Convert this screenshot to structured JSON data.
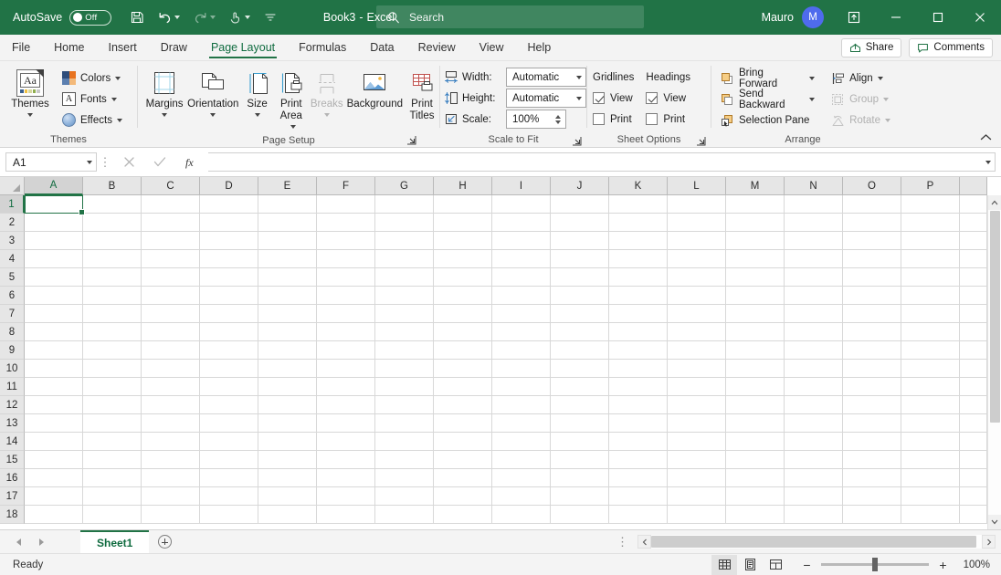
{
  "titlebar": {
    "autosave_label": "AutoSave",
    "autosave_state": "Off",
    "save_icon": "save-icon",
    "undo_icon": "undo-icon",
    "redo_icon": "redo-icon",
    "touch_icon": "touch-mode-icon",
    "customize_icon": "customize-quick-access-icon",
    "doc_title": "Book3",
    "doc_separator": "-",
    "app_name": "Excel",
    "search_placeholder": "Search",
    "search_icon": "search-icon",
    "user_name": "Mauro",
    "user_initial": "M",
    "ribbon_display_icon": "ribbon-display-options-icon",
    "minimize_icon": "minimize-icon",
    "maximize_icon": "maximize-icon",
    "close_icon": "close-icon",
    "accent_color": "#217346",
    "avatar_color": "#4f6bed"
  },
  "tabs": {
    "items": [
      {
        "label": "File",
        "active": false
      },
      {
        "label": "Home",
        "active": false
      },
      {
        "label": "Insert",
        "active": false
      },
      {
        "label": "Draw",
        "active": false
      },
      {
        "label": "Page Layout",
        "active": true
      },
      {
        "label": "Formulas",
        "active": false
      },
      {
        "label": "Data",
        "active": false
      },
      {
        "label": "Review",
        "active": false
      },
      {
        "label": "View",
        "active": false
      },
      {
        "label": "Help",
        "active": false
      }
    ],
    "share_label": "Share",
    "share_icon": "share-icon",
    "comments_label": "Comments",
    "comments_icon": "comments-icon",
    "collapse_icon": "collapse-ribbon-icon"
  },
  "ribbon": {
    "themes": {
      "group_label": "Themes",
      "themes_button": "Themes",
      "colors_label": "Colors",
      "fonts_label": "Fonts",
      "fonts_glyph": "A",
      "effects_label": "Effects",
      "themes_glyph": "Aa"
    },
    "page_setup": {
      "group_label": "Page Setup",
      "buttons": [
        {
          "label": "Margins",
          "icon": "margins-icon",
          "caret": true,
          "disabled": false
        },
        {
          "label": "Orientation",
          "icon": "orientation-icon",
          "caret": true,
          "disabled": false
        },
        {
          "label": "Size",
          "icon": "size-icon",
          "caret": true,
          "disabled": false
        },
        {
          "label": "Print",
          "label2": "Area",
          "icon": "print-area-icon",
          "caret": true,
          "inline_caret": true,
          "disabled": false
        },
        {
          "label": "Breaks",
          "icon": "breaks-icon",
          "caret": true,
          "disabled": true
        },
        {
          "label": "Background",
          "icon": "background-icon",
          "caret": false,
          "disabled": false
        },
        {
          "label": "Print",
          "label2": "Titles",
          "icon": "print-titles-icon",
          "caret": false,
          "disabled": false
        }
      ],
      "dialog_launcher_icon": "dialog-launcher-icon",
      "highlight_color": "#e81123"
    },
    "scale_to_fit": {
      "group_label": "Scale to Fit",
      "width_label": "Width:",
      "width_value": "Automatic",
      "width_icon": "fit-width-icon",
      "height_label": "Height:",
      "height_value": "Automatic",
      "height_icon": "fit-height-icon",
      "scale_label": "Scale:",
      "scale_value": "100%",
      "scale_icon": "scale-icon",
      "dialog_launcher_icon": "dialog-launcher-icon"
    },
    "sheet_options": {
      "group_label": "Sheet Options",
      "gridlines_header": "Gridlines",
      "headings_header": "Headings",
      "gridlines_view": {
        "label": "View",
        "checked": true
      },
      "gridlines_print": {
        "label": "Print",
        "checked": false
      },
      "headings_view": {
        "label": "View",
        "checked": true
      },
      "headings_print": {
        "label": "Print",
        "checked": false
      },
      "dialog_launcher_icon": "dialog-launcher-icon"
    },
    "arrange": {
      "group_label": "Arrange",
      "items": [
        {
          "label": "Bring Forward",
          "icon": "bring-forward-icon",
          "caret": true,
          "disabled": false
        },
        {
          "label": "Send Backward",
          "icon": "send-backward-icon",
          "caret": true,
          "disabled": false
        },
        {
          "label": "Selection Pane",
          "icon": "selection-pane-icon",
          "caret": false,
          "disabled": false
        },
        {
          "label": "Align",
          "icon": "align-icon",
          "caret": true,
          "disabled": false
        },
        {
          "label": "Group",
          "icon": "group-icon",
          "caret": true,
          "disabled": true
        },
        {
          "label": "Rotate",
          "icon": "rotate-icon",
          "caret": true,
          "disabled": true
        }
      ]
    }
  },
  "formula_bar": {
    "name_box_value": "A1",
    "name_box_caret_icon": "chevron-down-icon",
    "cancel_icon": "cancel-icon",
    "enter_icon": "enter-icon",
    "function_icon": "insert-function-icon",
    "formula_value": "",
    "expand_icon": "expand-formula-bar-icon"
  },
  "grid": {
    "columns": [
      "A",
      "B",
      "C",
      "D",
      "E",
      "F",
      "G",
      "H",
      "I",
      "J",
      "K",
      "L",
      "M",
      "N",
      "O",
      "P"
    ],
    "rows": [
      1,
      2,
      3,
      4,
      5,
      6,
      7,
      8,
      9,
      10,
      11,
      12,
      13,
      14,
      15,
      16,
      17,
      18
    ],
    "selected_cell": "A1",
    "selected_column": "A",
    "selected_row": 1,
    "selection_color": "#217346",
    "scroll_up_icon": "scroll-up-icon",
    "scroll_down_icon": "scroll-down-icon"
  },
  "sheet_bar": {
    "prev_icon": "previous-sheet-icon",
    "next_icon": "next-sheet-icon",
    "sheets": [
      {
        "name": "Sheet1",
        "active": true
      }
    ],
    "add_sheet_icon": "add-sheet-icon",
    "overflow_icon": "sheet-tab-overflow-icon",
    "scroll_left_icon": "scroll-left-icon",
    "scroll_right_icon": "scroll-right-icon"
  },
  "status_bar": {
    "status_text": "Ready",
    "views": [
      {
        "name": "normal-view",
        "icon": "normal-view-icon",
        "active": true
      },
      {
        "name": "page-layout-view",
        "icon": "page-layout-view-icon",
        "active": false
      },
      {
        "name": "page-break-preview",
        "icon": "page-break-preview-icon",
        "active": false
      }
    ],
    "zoom_out_label": "−",
    "zoom_in_label": "+",
    "zoom_value": "100%"
  }
}
